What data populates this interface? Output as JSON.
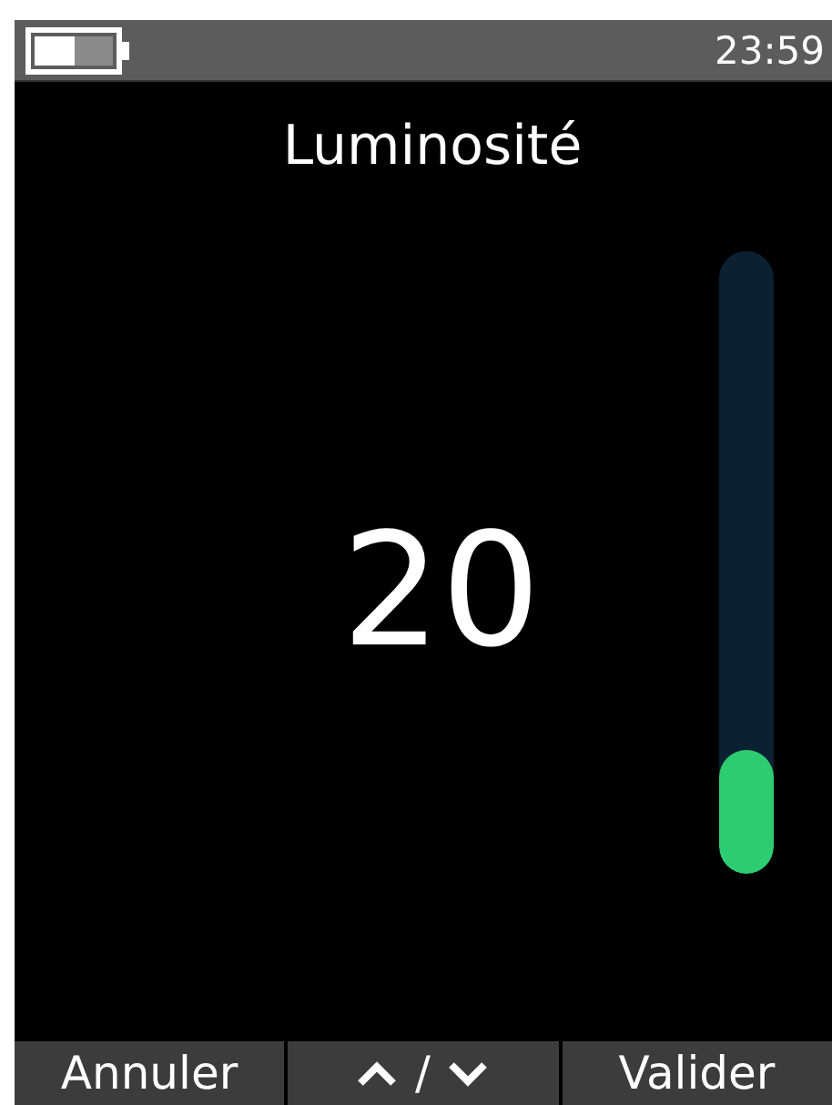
{
  "status_bar": {
    "time": "23:59"
  },
  "title": "Luminosité",
  "value": "20",
  "slider": {
    "level": 0.2
  },
  "softkeys": [
    {
      "kind": "text",
      "label": "Annuler"
    },
    {
      "kind": "arrows",
      "label": "/"
    },
    {
      "kind": "text",
      "label": "Valider"
    }
  ]
}
